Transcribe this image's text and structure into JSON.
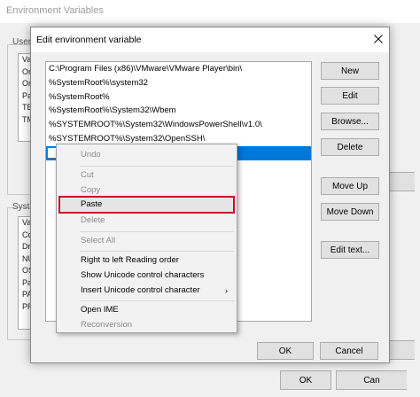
{
  "background_window": {
    "title": "Environment Variables",
    "user_group_label": "User",
    "system_group_label": "Syste",
    "user_list_rows": [
      "Va",
      "On",
      "On",
      "Pa",
      "TE",
      "TM"
    ],
    "system_list_rows": [
      "Va",
      "Co",
      "Dr",
      "NU",
      "OS",
      "Pa",
      "PA",
      "PR"
    ],
    "ok_label": "OK",
    "cancel_label": "Can"
  },
  "dialog": {
    "title": "Edit environment variable",
    "paths": [
      "C:\\Program Files (x86)\\VMware\\VMware Player\\bin\\",
      "%SystemRoot%\\system32",
      "%SystemRoot%",
      "%SystemRoot%\\System32\\Wbem",
      "%SYSTEMROOT%\\System32\\WindowsPowerShell\\v1.0\\",
      "%SYSTEMROOT%\\System32\\OpenSSH\\"
    ],
    "buttons": {
      "new": "New",
      "edit": "Edit",
      "browse": "Browse...",
      "delete": "Delete",
      "move_up": "Move Up",
      "move_down": "Move Down",
      "edit_text": "Edit text...",
      "ok": "OK",
      "cancel": "Cancel"
    }
  },
  "context_menu": {
    "undo": "Undo",
    "cut": "Cut",
    "copy": "Copy",
    "paste": "Paste",
    "delete": "Delete",
    "select_all": "Select All",
    "rtl_order": "Right to left Reading order",
    "show_unicode": "Show Unicode control characters",
    "insert_unicode": "Insert Unicode control character",
    "submenu_arrow": "›",
    "open_ime": "Open IME",
    "reconversion": "Reconversion"
  },
  "colors": {
    "selection": "#0078d7",
    "highlight_box": "#c8102e"
  },
  "icons": {
    "close": "close-icon",
    "submenu": "chevron-right-icon"
  }
}
